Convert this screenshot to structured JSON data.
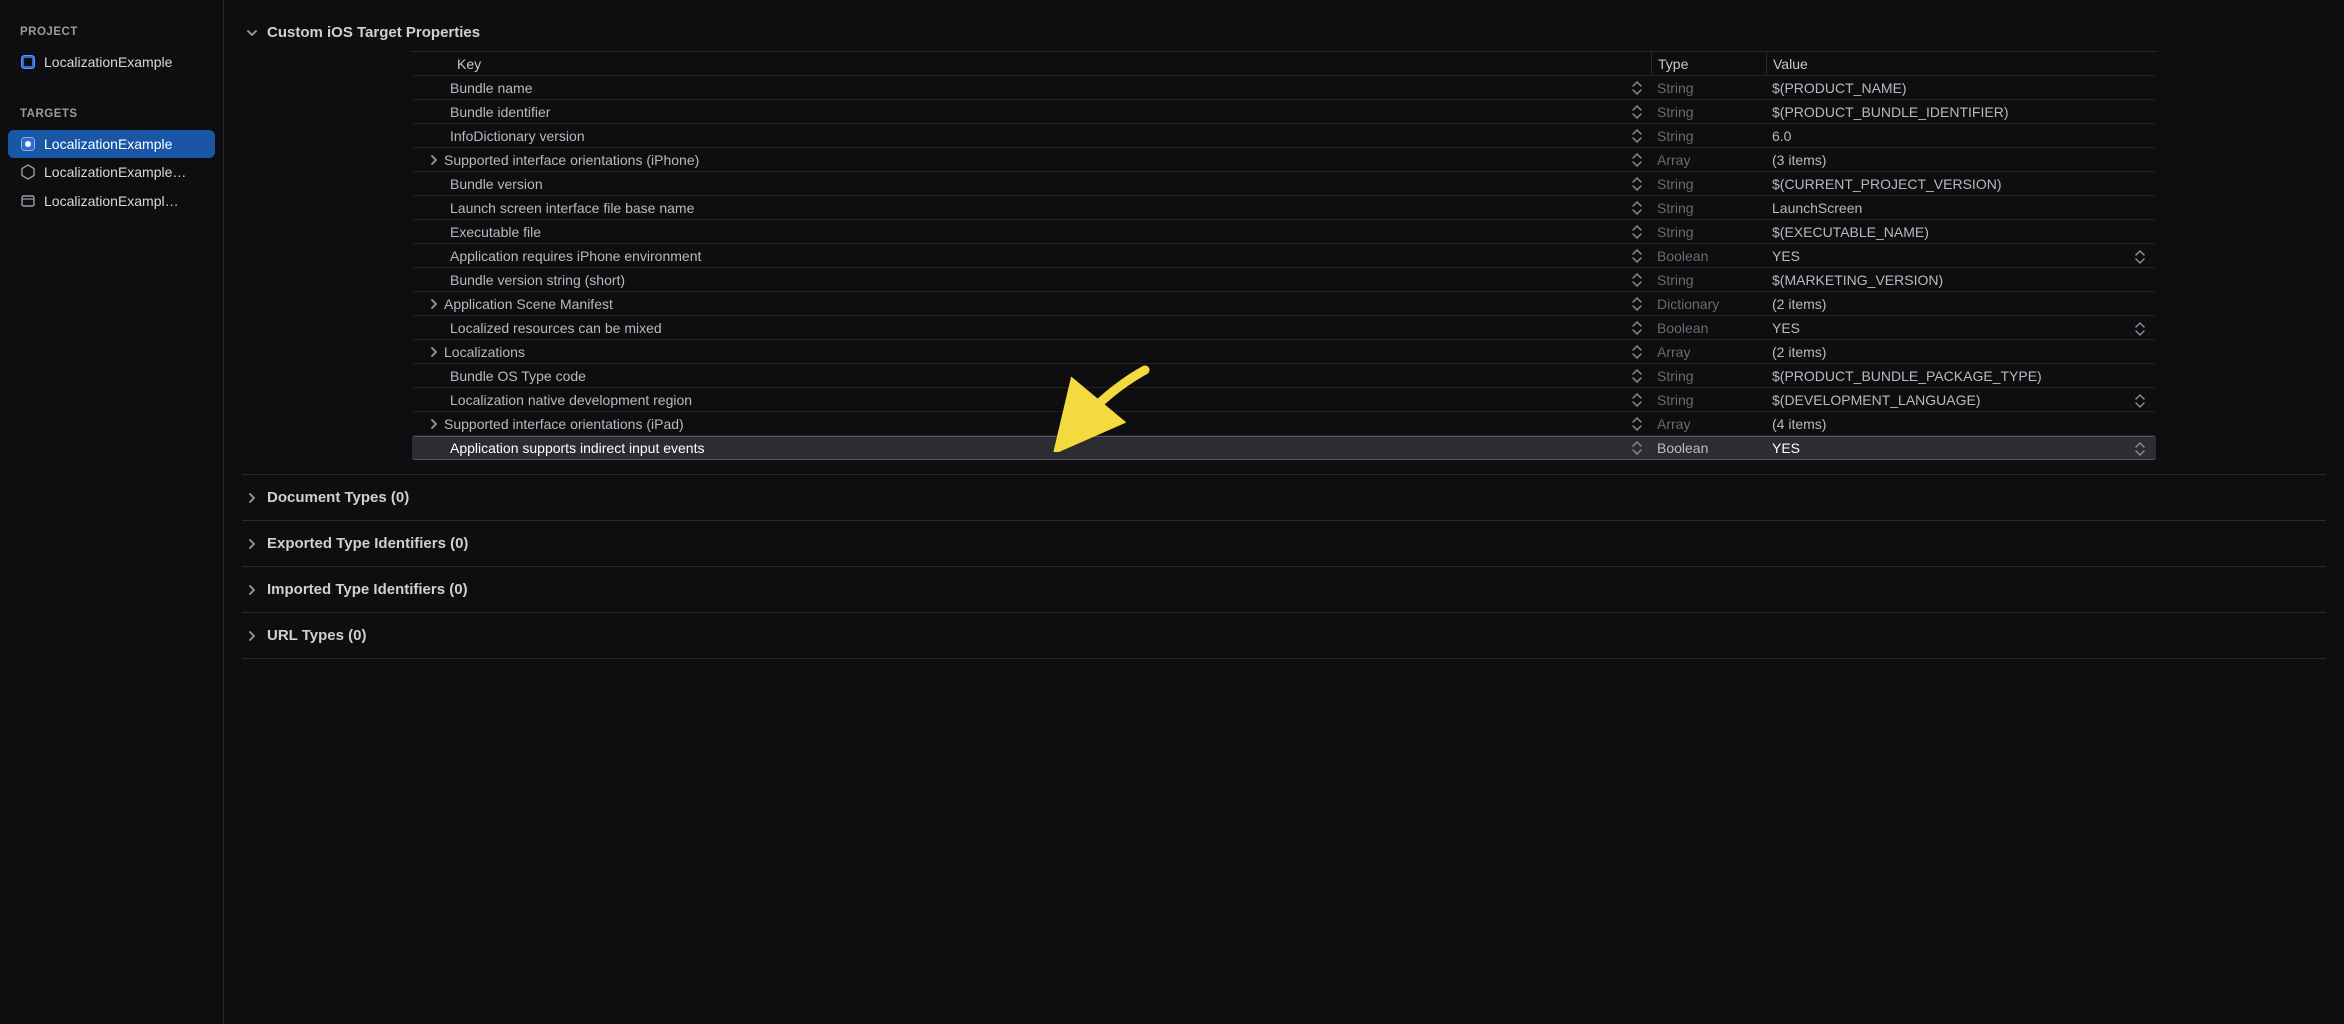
{
  "sidebar": {
    "project_heading": "PROJECT",
    "project_items": [
      {
        "label": "LocalizationExample",
        "icon": "project"
      }
    ],
    "targets_heading": "TARGETS",
    "target_items": [
      {
        "label": "LocalizationExample",
        "icon": "app",
        "selected": true
      },
      {
        "label": "LocalizationExample…",
        "icon": "test"
      },
      {
        "label": "LocalizationExampl…",
        "icon": "uitest"
      }
    ]
  },
  "sections": [
    {
      "title": "Custom iOS Target Properties",
      "expanded": true
    },
    {
      "title": "Document Types (0)",
      "expanded": false
    },
    {
      "title": "Exported Type Identifiers (0)",
      "expanded": false
    },
    {
      "title": "Imported Type Identifiers (0)",
      "expanded": false
    },
    {
      "title": "URL Types (0)",
      "expanded": false
    }
  ],
  "plist": {
    "columns": {
      "key": "Key",
      "type": "Type",
      "value": "Value"
    },
    "rows": [
      {
        "key": "Bundle name",
        "type": "String",
        "value": "$(PRODUCT_NAME)"
      },
      {
        "key": "Bundle identifier",
        "type": "String",
        "value": "$(PRODUCT_BUNDLE_IDENTIFIER)"
      },
      {
        "key": "InfoDictionary version",
        "type": "String",
        "value": "6.0"
      },
      {
        "key": "Supported interface orientations (iPhone)",
        "type": "Array",
        "value": "(3 items)",
        "expandable": true
      },
      {
        "key": "Bundle version",
        "type": "String",
        "value": "$(CURRENT_PROJECT_VERSION)"
      },
      {
        "key": "Launch screen interface file base name",
        "type": "String",
        "value": "LaunchScreen"
      },
      {
        "key": "Executable file",
        "type": "String",
        "value": "$(EXECUTABLE_NAME)"
      },
      {
        "key": "Application requires iPhone environment",
        "type": "Boolean",
        "value": "YES",
        "boolean": true
      },
      {
        "key": "Bundle version string (short)",
        "type": "String",
        "value": "$(MARKETING_VERSION)"
      },
      {
        "key": "Application Scene Manifest",
        "type": "Dictionary",
        "value": "(2 items)",
        "expandable": true
      },
      {
        "key": "Localized resources can be mixed",
        "type": "Boolean",
        "value": "YES",
        "boolean": true
      },
      {
        "key": "Localizations",
        "type": "Array",
        "value": "(2 items)",
        "expandable": true
      },
      {
        "key": "Bundle OS Type code",
        "type": "String",
        "value": "$(PRODUCT_BUNDLE_PACKAGE_TYPE)"
      },
      {
        "key": "Localization native development region",
        "type": "String",
        "value": "$(DEVELOPMENT_LANGUAGE)",
        "boolean": true
      },
      {
        "key": "Supported interface orientations (iPad)",
        "type": "Array",
        "value": "(4 items)",
        "expandable": true
      },
      {
        "key": "Application supports indirect input events",
        "type": "Boolean",
        "value": "YES",
        "boolean": true,
        "selected": true
      }
    ]
  }
}
